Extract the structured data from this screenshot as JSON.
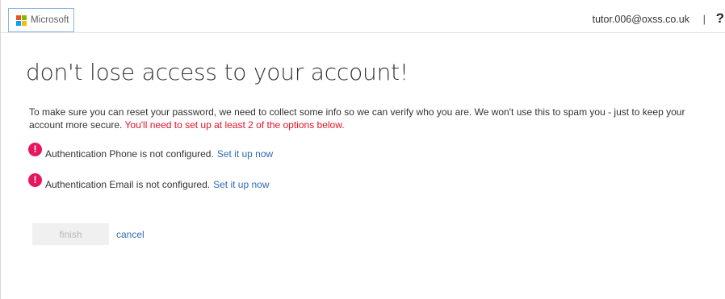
{
  "header": {
    "logo_text": "Microsoft",
    "user_email": "tutor.006@oxss.co.uk",
    "separator": "|",
    "help_glyph": "?"
  },
  "main": {
    "title": "don't lose access to your account!",
    "intro": "To make sure you can reset your password, we need to collect some info so we can verify who you are. We won't use this to spam you - just to keep your account more secure.",
    "warning": "You'll need to set up at least 2 of the options below.",
    "methods": [
      {
        "text": "Authentication Phone is not configured.",
        "link": "Set it up now",
        "icon": "alert-icon"
      },
      {
        "text": "Authentication Email is not configured.",
        "link": "Set it up now",
        "icon": "alert-icon"
      }
    ],
    "alert_glyph": "!",
    "finish_label": "finish",
    "cancel_label": "cancel"
  },
  "colors": {
    "ms_red": "#f25022",
    "ms_green": "#7fba00",
    "ms_blue": "#00a4ef",
    "ms_yellow": "#ffb900",
    "alert": "#e8175d",
    "warning_text": "#e81123",
    "link": "#2e6bb5"
  }
}
